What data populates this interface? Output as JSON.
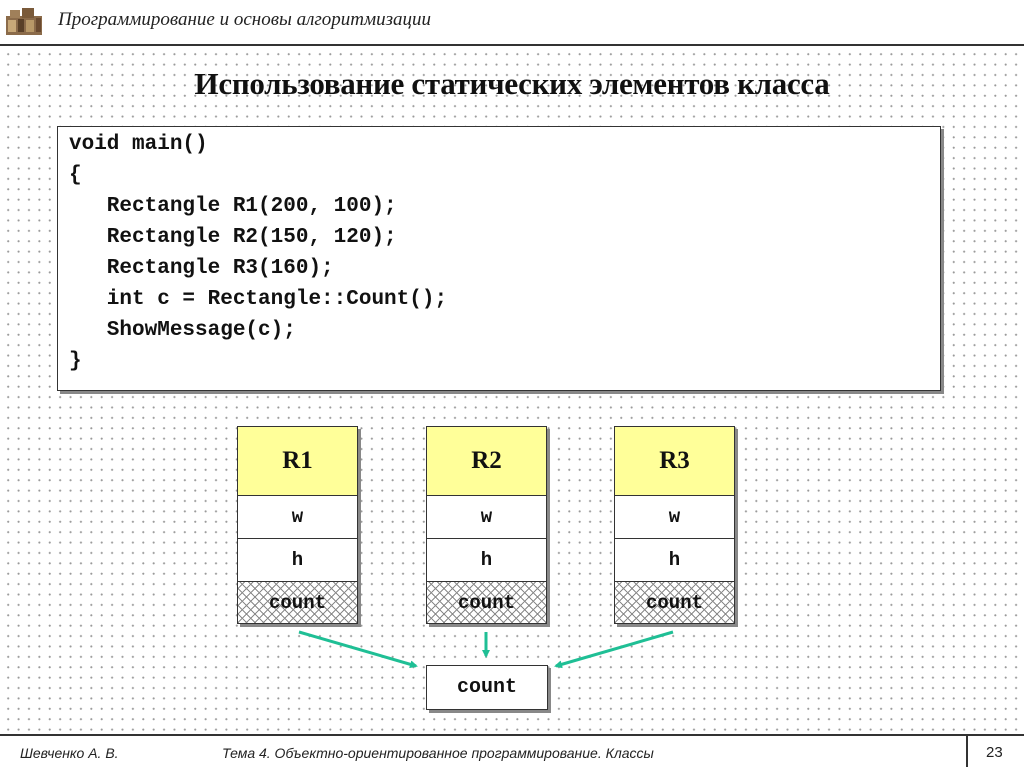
{
  "header": {
    "logo_icon": "book-stack-logo",
    "title": "Программирование и основы алгоритмизации"
  },
  "slide": {
    "title": "Использование статических элементов класса"
  },
  "code": {
    "lines": [
      "void main()",
      "{",
      "   Rectangle R1(200, 100);",
      "   Rectangle R2(150, 120);",
      "   Rectangle R3(160);",
      "   int c = Rectangle::Count();",
      "   ShowMessage(c);",
      "}"
    ]
  },
  "diagram": {
    "objects": [
      {
        "name": "R1",
        "fields": [
          "w",
          "h",
          "count"
        ]
      },
      {
        "name": "R2",
        "fields": [
          "w",
          "h",
          "count"
        ]
      },
      {
        "name": "R3",
        "fields": [
          "w",
          "h",
          "count"
        ]
      }
    ],
    "shared_static": "count",
    "colors": {
      "object_header": "#ffff99",
      "arrow": "#1fbf95",
      "border": "#333333"
    }
  },
  "footer": {
    "author": "Шевченко А. В.",
    "topic": "Тема 4. Объектно-ориентированное программирование. Классы",
    "page": "23"
  }
}
